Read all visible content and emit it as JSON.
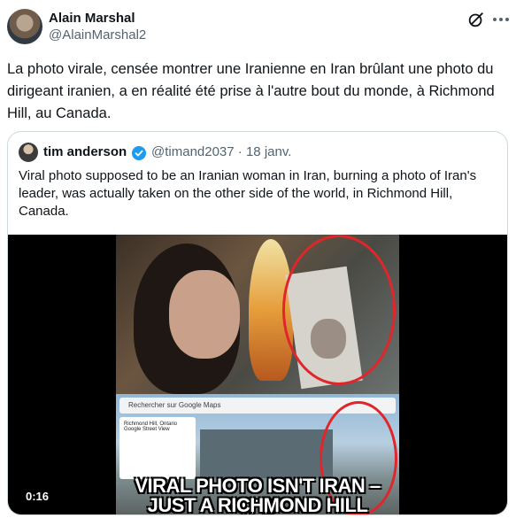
{
  "author": {
    "name": "Alain Marshal",
    "handle": "@AlainMarshal2"
  },
  "tweet": {
    "text": "La photo virale, censée montrer une Iranienne en Iran brûlant une photo du dirigeant iranien, a en réalité été prise à l'autre bout du monde, à Richmond Hill, au Canada."
  },
  "quoted": {
    "name": "tim anderson",
    "handle": "@timand2037",
    "separator": "·",
    "date": "18 janv.",
    "text": "Viral photo supposed to be an Iranian woman in Iran, burning a photo of Iran's leader, was actually taken on the other side of the world, in Richmond Hill, Canada."
  },
  "video": {
    "timestamp": "0:16",
    "caption_line1": "VIRAL PHOTO ISN'T IRAN – IT'S",
    "caption_line2": "JUST A RICHMOND HILL PARKING LOT",
    "maps_search": "Rechercher sur Google Maps",
    "maps_card_title": "Richmond Hill, Ontario",
    "maps_card_sub": "Google Street View"
  },
  "colors": {
    "text": "#0f1419",
    "secondary": "#536471",
    "border": "#cfd9de",
    "verified": "#1d9bf0",
    "annotation_red": "#e0262a"
  },
  "icons": [
    "grok-icon",
    "more-icon",
    "verified-badge-icon"
  ]
}
